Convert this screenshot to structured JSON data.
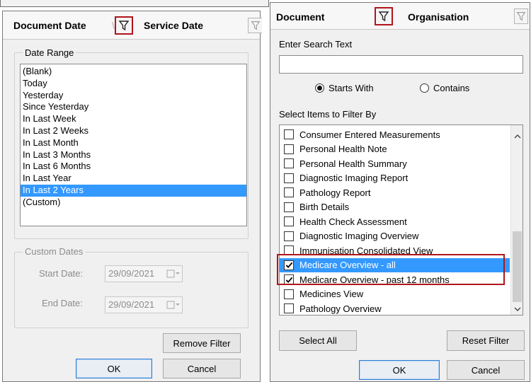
{
  "left_panel": {
    "columns": [
      "Document Date",
      "Service Date"
    ],
    "date_range": {
      "title": "Date Range",
      "items": [
        "(Blank)",
        "Today",
        "Yesterday",
        "Since Yesterday",
        "In Last Week",
        "In Last 2 Weeks",
        "In Last Month",
        "In Last 3 Months",
        "In Last 6 Months",
        "In Last Year",
        "In Last 2 Years",
        "(Custom)"
      ],
      "selected_index": 10
    },
    "custom_dates": {
      "title": "Custom Dates",
      "start_label": "Start Date:",
      "start_value": "29/09/2021",
      "end_label": "End Date:",
      "end_value": "29/09/2021"
    },
    "remove_filter": "Remove Filter",
    "ok": "OK",
    "cancel": "Cancel"
  },
  "right_panel": {
    "columns": [
      "Document",
      "Organisation"
    ],
    "search_label": "Enter Search Text",
    "search_value": "",
    "radio_starts": "Starts With",
    "radio_contains": "Contains",
    "radio_selected": "starts",
    "filter_label": "Select Items to Filter By",
    "items": [
      {
        "label": "Consumer Entered Measurements",
        "checked": false
      },
      {
        "label": "Personal Health Note",
        "checked": false
      },
      {
        "label": "Personal Health Summary",
        "checked": false
      },
      {
        "label": "Diagnostic Imaging Report",
        "checked": false
      },
      {
        "label": "Pathology Report",
        "checked": false
      },
      {
        "label": "Birth Details",
        "checked": false
      },
      {
        "label": "Health Check Assessment",
        "checked": false
      },
      {
        "label": "Diagnostic Imaging Overview",
        "checked": false
      },
      {
        "label": "Immunisation Consolidated View",
        "checked": false
      },
      {
        "label": "Medicare Overview - all",
        "checked": true
      },
      {
        "label": "Medicare Overview - past 12 months",
        "checked": true
      },
      {
        "label": "Medicines View",
        "checked": false
      },
      {
        "label": "Pathology Overview",
        "checked": false
      }
    ],
    "selected_index": 9,
    "select_all": "Select All",
    "reset_filter": "Reset Filter",
    "ok": "OK",
    "cancel": "Cancel"
  },
  "colors": {
    "selection": "#3399ff",
    "highlight": "#b0151b"
  }
}
